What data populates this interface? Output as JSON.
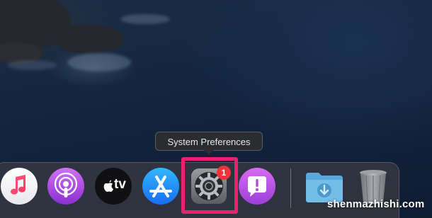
{
  "tooltip": {
    "text": "System Preferences"
  },
  "dock": {
    "apps": [
      {
        "name": "Music",
        "icon": "music-icon"
      },
      {
        "name": "Podcasts",
        "icon": "podcasts-icon"
      },
      {
        "name": "TV",
        "icon": "apple-tv-icon",
        "label": "tv"
      },
      {
        "name": "App Store",
        "icon": "app-store-icon"
      },
      {
        "name": "System Preferences",
        "icon": "gear-icon",
        "badge": "1",
        "highlighted": true
      },
      {
        "name": "Feedback Assistant",
        "icon": "feedback-icon"
      }
    ],
    "others": [
      {
        "name": "Downloads",
        "icon": "downloads-folder-icon"
      },
      {
        "name": "Trash",
        "icon": "trash-icon"
      }
    ]
  },
  "watermark": "shenmazhishi.com",
  "colors": {
    "highlight": "#e8226e",
    "badge": "#f0323a",
    "wallpaper": "#142640"
  }
}
